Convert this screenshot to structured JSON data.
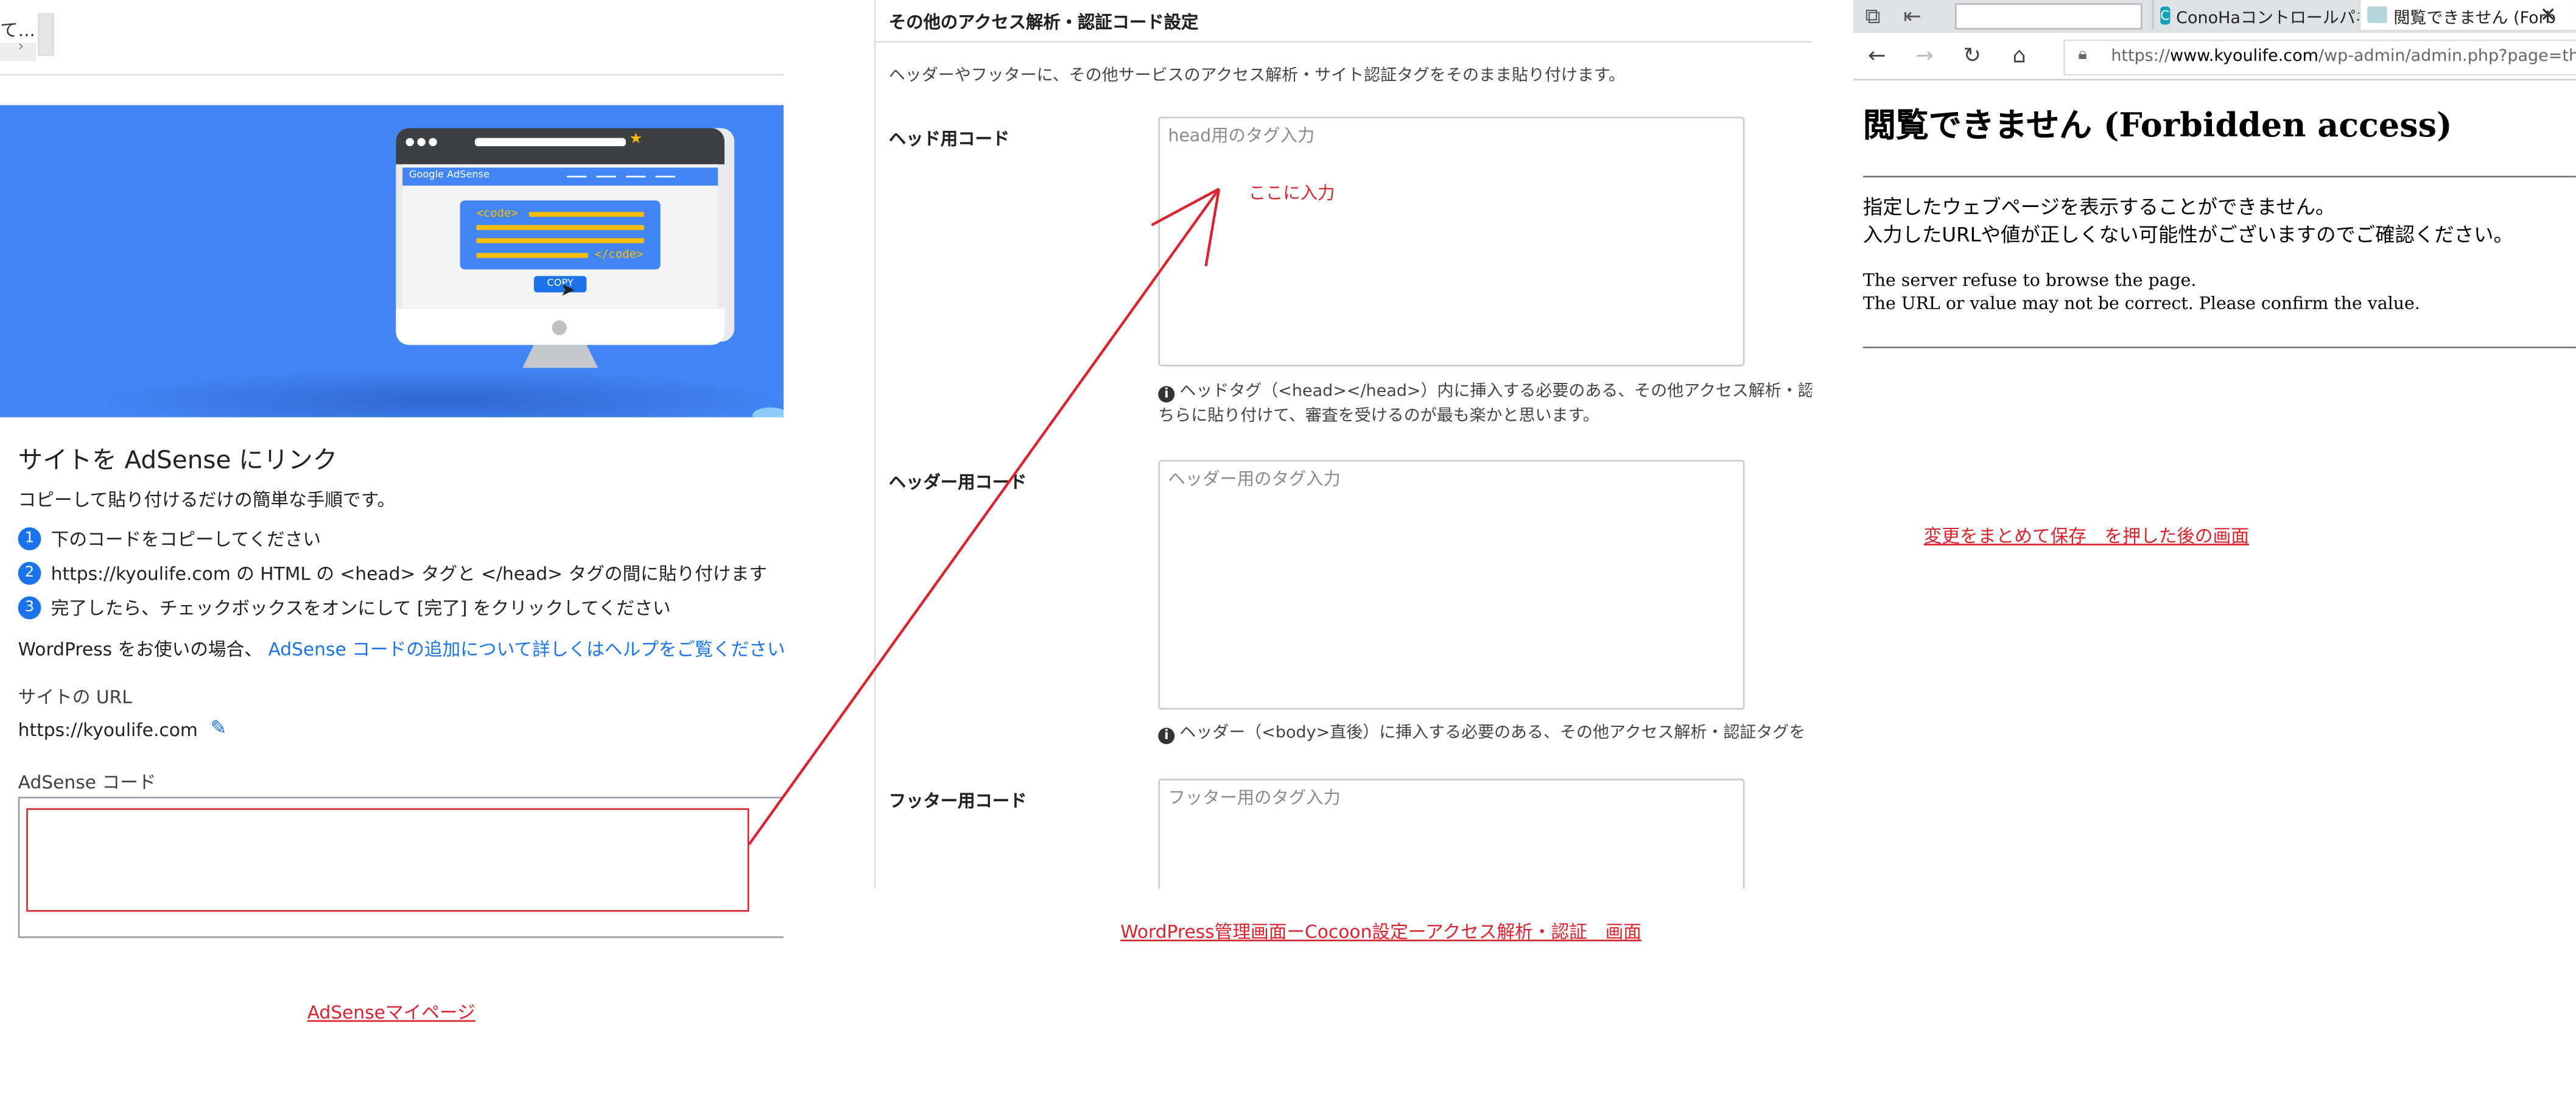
{
  "adsense": {
    "tab_stub": "て...",
    "title": "サイトを AdSense にリンク",
    "subtitle": "コピーして貼り付けるだけの簡単な手順です。",
    "steps": [
      {
        "num": "1",
        "text": "下のコードをコピーしてください"
      },
      {
        "num": "2",
        "text": "https://kyoulife.com の HTML の <head> タグと </head> タグの間に貼り付けます"
      },
      {
        "num": "3",
        "text": "完了したら、チェックボックスをオンにして [完了] をクリックしてください"
      }
    ],
    "wp_note_prefix": "WordPress をお使いの場合、",
    "wp_note_link": "AdSense コードの追加について詳しくはヘルプをご覧ください。",
    "site_url_label": "サイトの URL",
    "site_url_value": "https://kyoulife.com",
    "code_label": "AdSense コード",
    "banner": {
      "brand": "Google AdSense",
      "code_open": "<code>",
      "code_close": "</code>",
      "copy_button": "COPY",
      "colors": {
        "bg": "#4285f4",
        "code_bar": "#fbbc04"
      }
    },
    "caption": "AdSenseマイページ"
  },
  "cocoon": {
    "section_title": "その他のアクセス解析・認証コード設定",
    "description": "ヘッダーやフッターに、その他サービスのアクセス解析・サイト認証タグをそのまま貼り付けます。",
    "head_label": "ヘッド用コード",
    "head_placeholder": "head用のタグ入力",
    "head_note_line1": "ヘッドタグ（<head></head>）内に挿入する必要のある、その他アクセス解析・認",
    "head_note_line2": "ちらに貼り付けて、審査を受けるのが最も楽かと思います。",
    "header_label": "ヘッダー用コード",
    "header_placeholder": "ヘッダー用のタグ入力",
    "header_note": "ヘッダー（<body>直後）に挿入する必要のある、その他アクセス解析・認証タグを",
    "footer_label": "フッター用コード",
    "footer_placeholder": "フッター用のタグ入力",
    "annotation": "ここに入力",
    "caption": "WordPress管理画面ーCocoon設定ーアクセス解析・認証　画面"
  },
  "browser": {
    "tabs": [
      {
        "label": "ConoHaコントロールパネル",
        "icon": "conoha-icon"
      },
      {
        "label": "閲覧できません (Forb",
        "icon": "page-icon"
      }
    ],
    "url_prefix": "https://",
    "url_domain": "www.kyoulife.com",
    "url_path": "/wp-admin/admin.php?page=theme-sett",
    "heading_ja": "閲覧できません",
    "heading_en": "(Forbidden access)",
    "msg_ja_1": "指定したウェブページを表示することができません。",
    "msg_ja_2": "入力したURLや値が正しくない可能性がございますのでご確認ください。",
    "msg_en_1": "The server refuse to browse the page.",
    "msg_en_2": "The URL or value may not be correct. Please confirm the value.",
    "caption": "変更をまとめて保存　を押した後の画面"
  },
  "colors": {
    "annotation_red": "#d9232e",
    "link_blue": "#1a73e8"
  }
}
